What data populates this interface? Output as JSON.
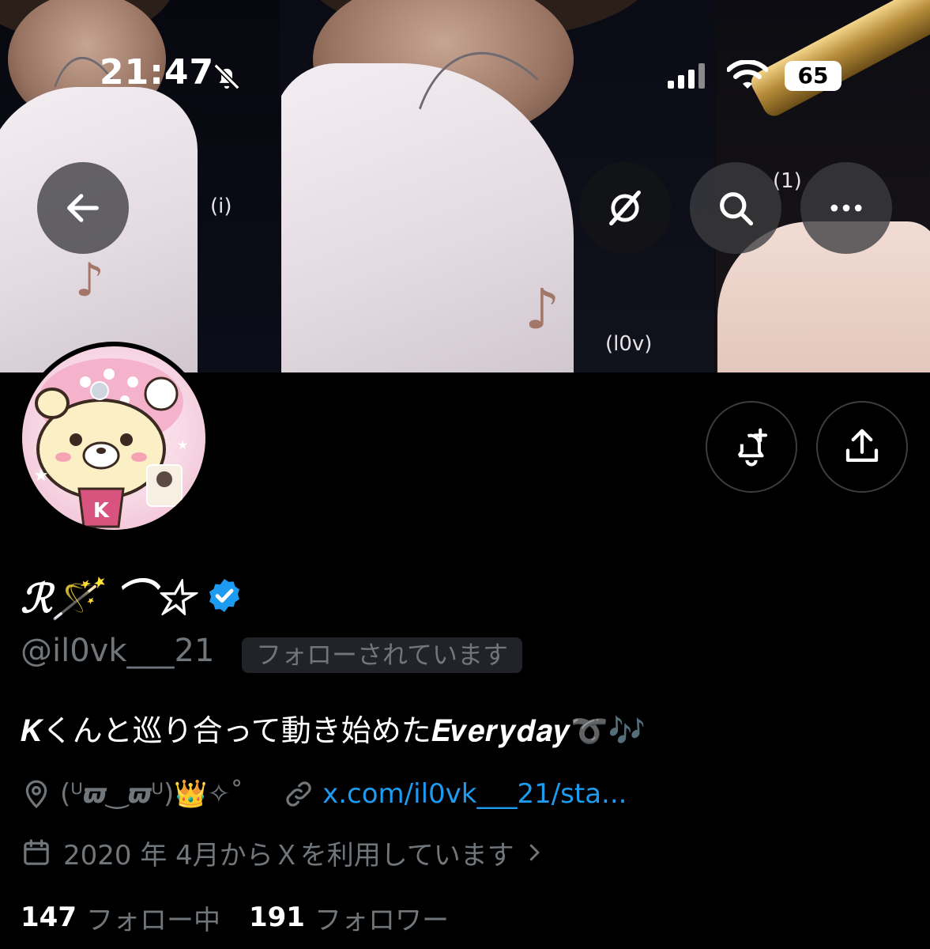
{
  "status_bar": {
    "time": "21:47",
    "battery": "65"
  },
  "banner": {
    "watermark_left": "(i)",
    "watermark_center": "(l0v)",
    "watermark_right": "(1)"
  },
  "profile": {
    "name": "ℛ🪄 ⌒☆",
    "handle": "@il0vk___21",
    "follows_you_badge": "フォローされています",
    "bio": "𝑲くんと巡り合って動き始めた𝑬𝒗𝒆𝒓𝒚𝒅𝒂𝒚➰🎶",
    "location": "(ᵁ𝟉‿𝟉ᵁ)👑✧˚",
    "website": "x.com/il0vk___21/sta...",
    "joined": "2020 年 4月からＸを利用しています",
    "following_count": "147",
    "following_label": "フォロー中",
    "followers_count": "191",
    "followers_label": "フォロワー"
  },
  "colors": {
    "accent": "#1d9bf0",
    "muted_text": "#71767b",
    "background": "#000000"
  },
  "icons": {
    "back": "arrow-left-icon",
    "grok": "grok-icon",
    "search": "search-icon",
    "more": "more-icon",
    "notify": "bell-plus-icon",
    "share": "share-icon",
    "location": "location-pin-icon",
    "link": "link-icon",
    "calendar": "calendar-icon"
  }
}
